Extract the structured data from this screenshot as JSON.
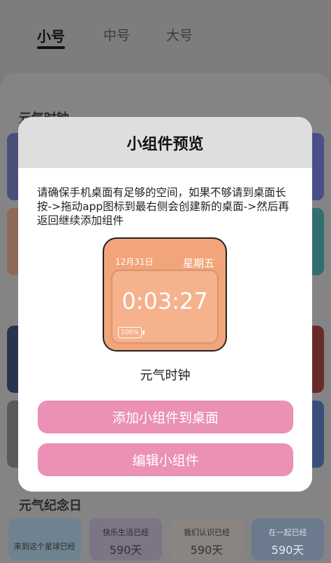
{
  "tabs": [
    {
      "label": "小号",
      "active": true
    },
    {
      "label": "中号",
      "active": false
    },
    {
      "label": "大号",
      "active": false
    }
  ],
  "sections": {
    "clock_title": "元气时钟",
    "anniversary_title": "元气纪念日"
  },
  "anniversary_cards": [
    {
      "text": "来到这个星球已经",
      "value": ""
    },
    {
      "text": "快乐生活已经",
      "value": "590天"
    },
    {
      "text": "我们认识已经",
      "value": "590天"
    },
    {
      "text": "在一起已经",
      "value": "590天"
    }
  ],
  "dialog": {
    "title": "小组件预览",
    "description": "请确保手机桌面有足够的空间，如果不够请到桌面长按->拖动app图标到最右侧会创建新的桌面->然后再返回继续添加组件",
    "widget": {
      "date": "12月31日",
      "weekday": "星期五",
      "time": "0:03:27",
      "battery": "100%",
      "name": "元气时钟"
    },
    "add_button": "添加小组件到桌面",
    "edit_button": "编辑小组件"
  },
  "colors": {
    "accent_pink": "#ea91b5",
    "widget_orange": "#f2a57b"
  }
}
